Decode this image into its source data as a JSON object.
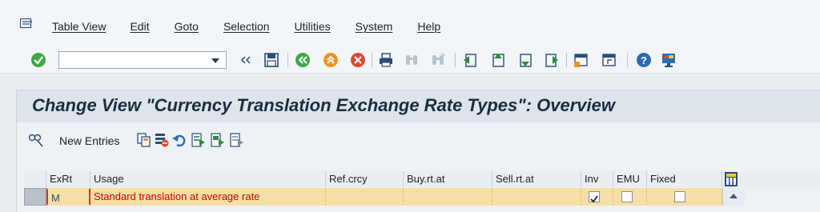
{
  "menu": {
    "items": [
      "Table View",
      "Edit",
      "Goto",
      "Selection",
      "Utilities",
      "System",
      "Help"
    ]
  },
  "toolbar": {
    "command_value": "",
    "icons": [
      "enter-icon",
      "save-icon",
      "back-icon",
      "exit-icon",
      "cancel-icon",
      "print-icon",
      "find-icon",
      "find-next-icon",
      "first-page-icon",
      "previous-page-icon",
      "next-page-icon",
      "last-page-icon",
      "create-session-icon",
      "shortcut-icon",
      "help-icon",
      "customize-layout-icon"
    ]
  },
  "screen": {
    "title": "Change View \"Currency Translation Exchange Rate Types\": Overview",
    "new_entries": "New Entries"
  },
  "table": {
    "headers": {
      "exrt": "ExRt",
      "usage": "Usage",
      "ref_crcy": "Ref.crcy",
      "buy_rt_at": "Buy.rt.at",
      "sell_rt_at": "Sell.rt.at",
      "inv": "Inv",
      "emu": "EMU",
      "fixed": "Fixed"
    },
    "rows": [
      {
        "exrt": "M",
        "usage": "Standard translation at average rate",
        "ref_crcy": "",
        "buy_rt_at": "",
        "sell_rt_at": "",
        "inv": true,
        "emu": false,
        "fixed": false
      }
    ]
  },
  "colors": {
    "row_highlight": "#f6dfa6",
    "text_red": "#c00000",
    "title_text": "#1c2c3f"
  }
}
